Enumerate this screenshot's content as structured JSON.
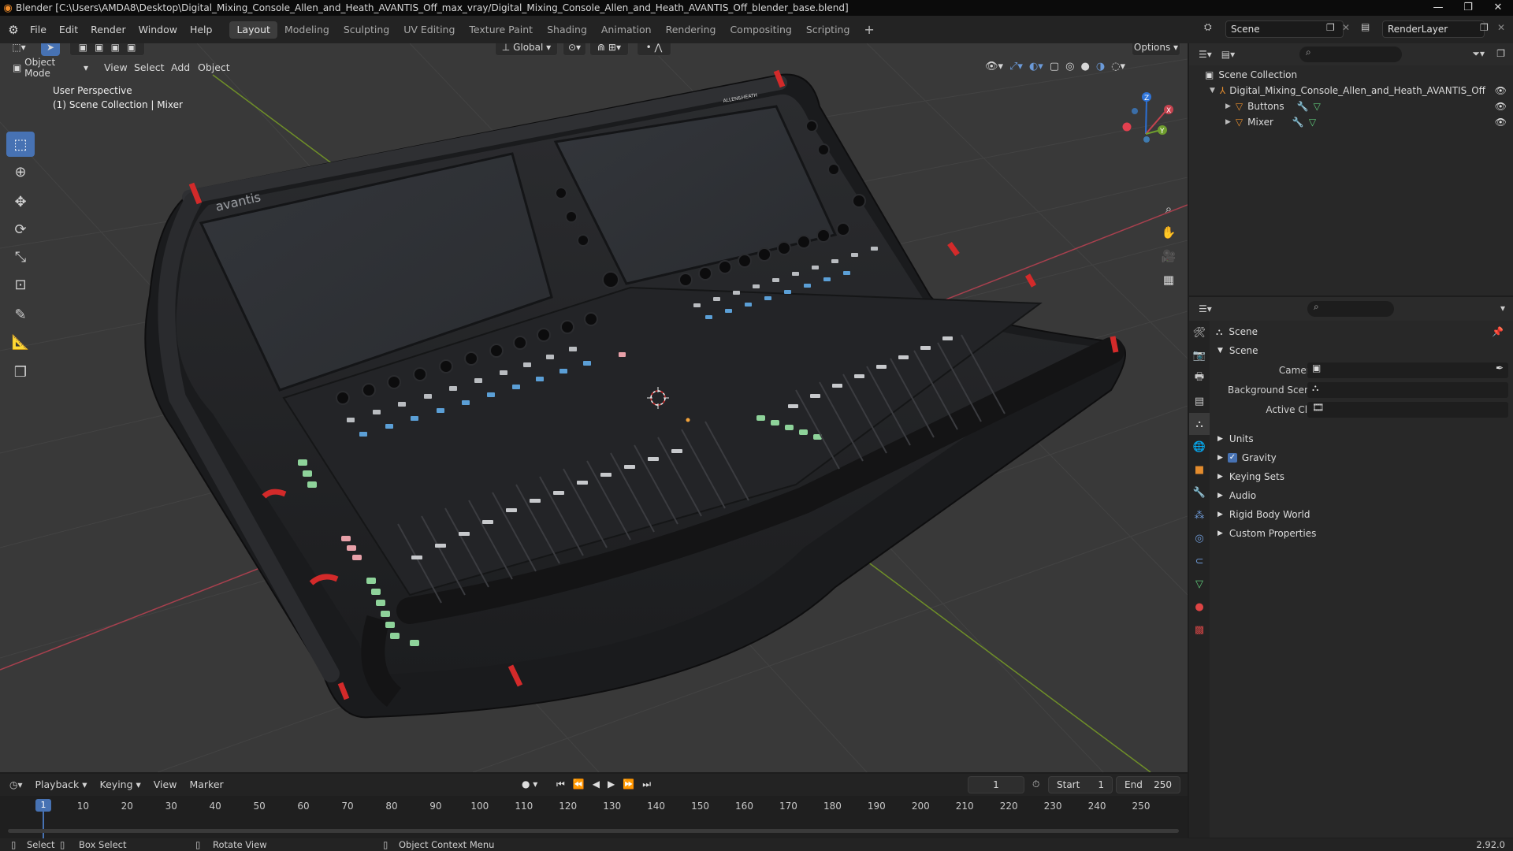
{
  "titlebar": {
    "title": "Blender [C:\\Users\\AMDA8\\Desktop\\Digital_Mixing_Console_Allen_and_Heath_AVANTIS_Off_max_vray/Digital_Mixing_Console_Allen_and_Heath_AVANTIS_Off_blender_base.blend]",
    "minimize": "—",
    "maximize": "❐",
    "close": "✕"
  },
  "menu": [
    "File",
    "Edit",
    "Render",
    "Window",
    "Help"
  ],
  "workspaces": [
    "Layout",
    "Modeling",
    "Sculpting",
    "UV Editing",
    "Texture Paint",
    "Shading",
    "Animation",
    "Rendering",
    "Compositing",
    "Scripting"
  ],
  "workspace_add": "+",
  "scene_name": "Scene",
  "view_layer": "RenderLayer",
  "viewport": {
    "transform_orientation": "Global",
    "options": "Options",
    "mode": "Object Mode",
    "menus": [
      "View",
      "Select",
      "Add",
      "Object"
    ],
    "perspective": "User Perspective",
    "collection_info": "(1) Scene Collection | Mixer",
    "gizmo": {
      "x": "X",
      "y": "Y",
      "z": "Z"
    },
    "model": {
      "brand_left": "avantis",
      "brand_right": "ALLEN&HEATH"
    }
  },
  "outliner": {
    "root": "Scene Collection",
    "items": [
      {
        "label": "Digital_Mixing_Console_Allen_and_Heath_AVANTIS_Off"
      },
      {
        "label": "Buttons"
      },
      {
        "label": "Mixer"
      }
    ]
  },
  "properties": {
    "header": "Scene",
    "section": "Scene",
    "camera_label": "Camera",
    "background_label": "Background Scene",
    "clip_label": "Active Clip",
    "panels": [
      "Units",
      "Gravity",
      "Keying Sets",
      "Audio",
      "Rigid Body World",
      "Custom Properties"
    ],
    "gravity_checked": true
  },
  "timeline": {
    "menus": [
      "Playback",
      "Keying",
      "View",
      "Marker"
    ],
    "current_frame": "1",
    "start_label": "Start",
    "start": "1",
    "end_label": "End",
    "end": "250",
    "ticks": [
      "1",
      "10",
      "20",
      "30",
      "40",
      "50",
      "60",
      "70",
      "80",
      "90",
      "100",
      "110",
      "120",
      "130",
      "140",
      "150",
      "160",
      "170",
      "180",
      "190",
      "200",
      "210",
      "220",
      "230",
      "240",
      "250"
    ]
  },
  "status": {
    "select": "Select",
    "box_select": "Box Select",
    "rotate": "Rotate View",
    "context_menu": "Object Context Menu",
    "version": "2.92.0"
  },
  "colors": {
    "accent_blue": "#4772b3",
    "viewport_bg": "#393939",
    "axis_red": "#b3404f",
    "axis_green": "#7a9e2a"
  }
}
